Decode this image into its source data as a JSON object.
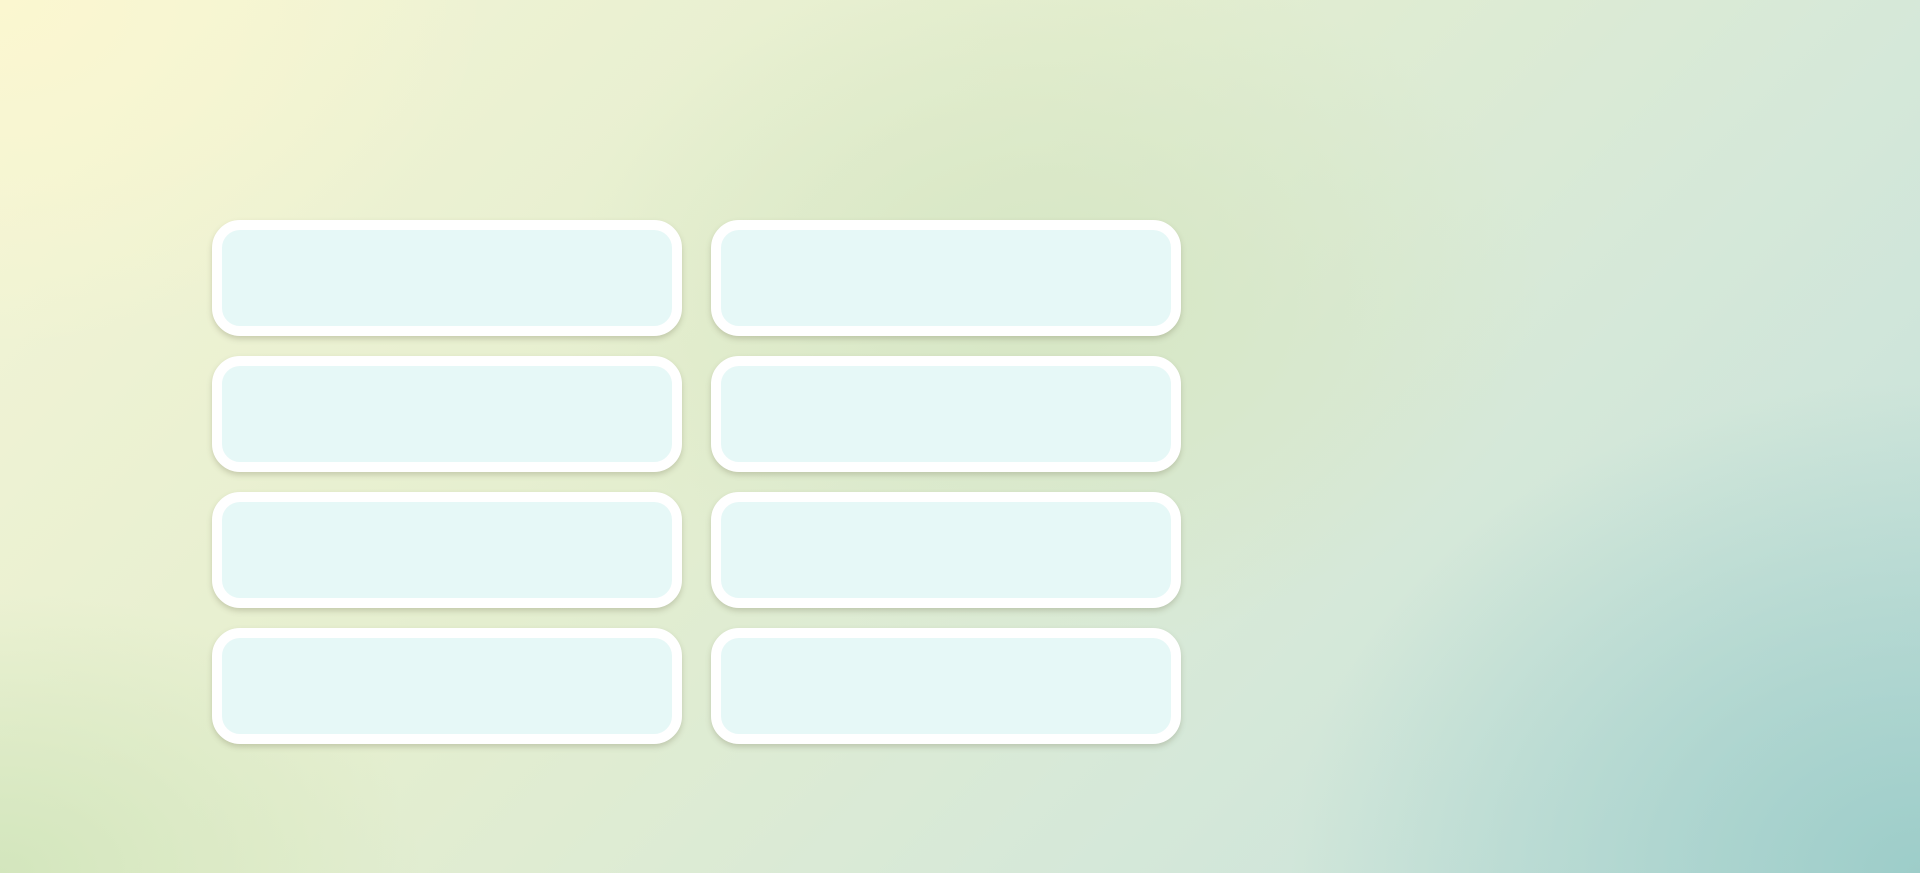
{
  "cards": [
    {
      "id": 1
    },
    {
      "id": 2
    },
    {
      "id": 3
    },
    {
      "id": 4
    },
    {
      "id": 5
    },
    {
      "id": 6
    },
    {
      "id": 7
    },
    {
      "id": 8
    }
  ],
  "colors": {
    "card_fill": "#e6f8f7",
    "card_border": "#ffffff"
  }
}
